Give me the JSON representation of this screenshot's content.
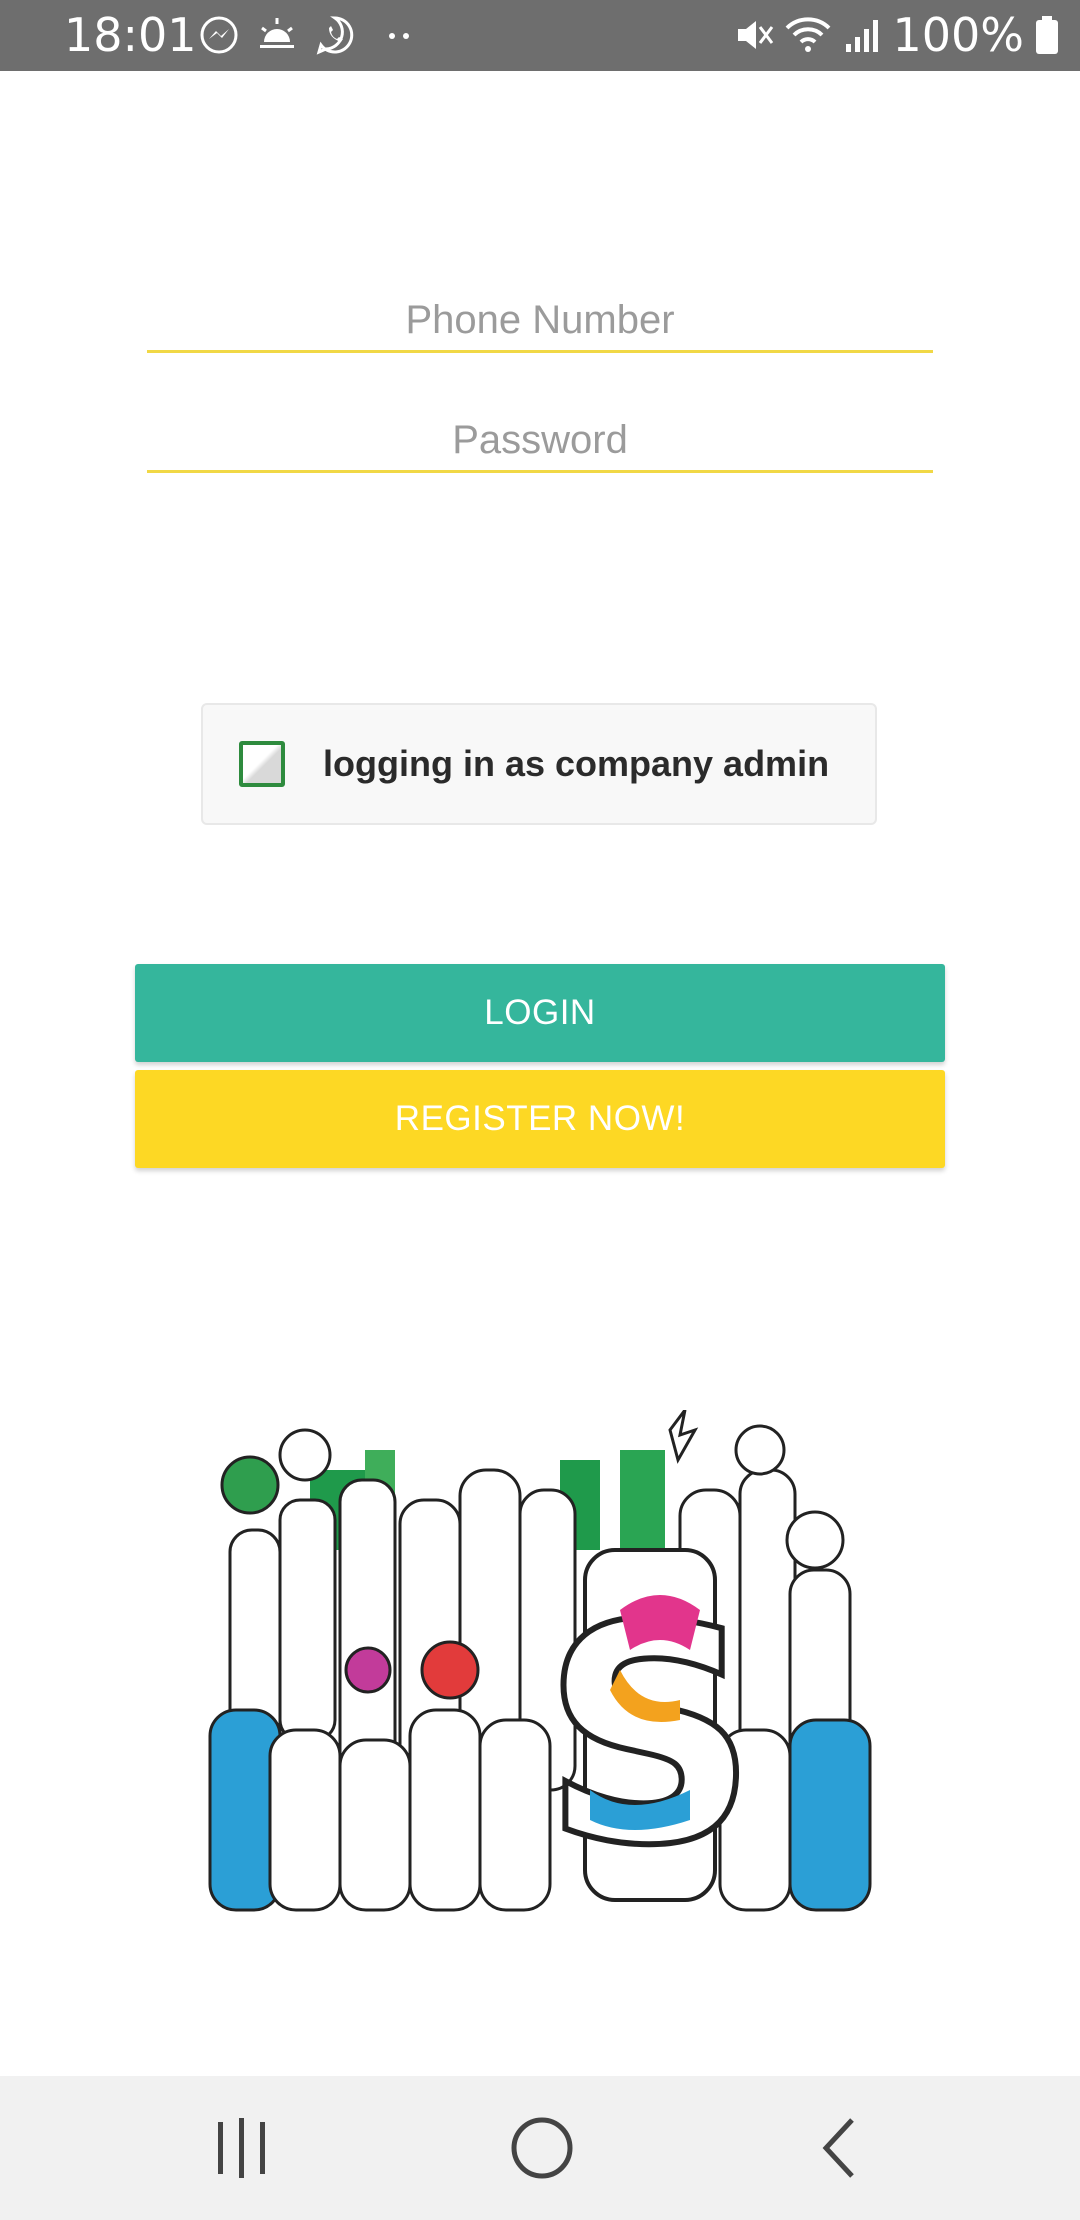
{
  "status_bar": {
    "time": "18:01",
    "battery": "100%",
    "notification_icons": [
      "messenger-icon",
      "weather-icon",
      "whatsapp-icon",
      "more-notifications-icon"
    ],
    "system_icons": [
      "mute-icon",
      "wifi-icon",
      "signal-icon",
      "battery-icon"
    ]
  },
  "form": {
    "phone_placeholder": "Phone Number",
    "phone_value": "",
    "password_placeholder": "Password",
    "password_value": "",
    "admin_checkbox_label": "logging in as company admin",
    "admin_checked": false
  },
  "buttons": {
    "login_label": "LOGIN",
    "register_label": "REGISTER NOW!"
  },
  "colors": {
    "accent_yellow": "#fdd824",
    "accent_teal": "#35b69c",
    "underline_yellow": "#f1d846",
    "checkbox_green": "#2e8b3e"
  },
  "nav_bar": {
    "icons": [
      "recent-apps-icon",
      "home-icon",
      "back-icon"
    ]
  }
}
